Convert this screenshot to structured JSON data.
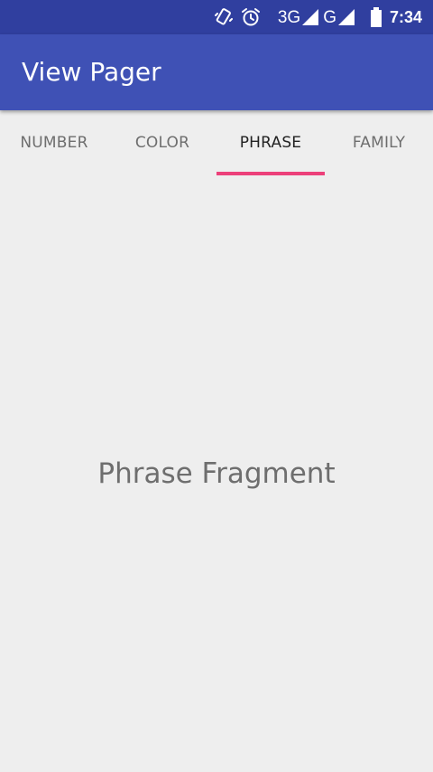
{
  "status_bar": {
    "icons": [
      "vibrate-icon",
      "alarm-icon",
      "signal-3g-icon",
      "signal-g-icon",
      "battery-icon"
    ],
    "network_1": "3G",
    "network_2": "G",
    "time": "7:34"
  },
  "app_bar": {
    "title": "View Pager"
  },
  "tabs": [
    {
      "label": "NUMBER",
      "active": false
    },
    {
      "label": "COLOR",
      "active": false
    },
    {
      "label": "PHRASE",
      "active": true
    },
    {
      "label": "FAMILY",
      "active": false
    }
  ],
  "content": {
    "text": "Phrase Fragment"
  },
  "colors": {
    "status_bar": "#303f9f",
    "app_bar": "#3f51b5",
    "indicator": "#ec407a",
    "background": "#eeeeee"
  }
}
